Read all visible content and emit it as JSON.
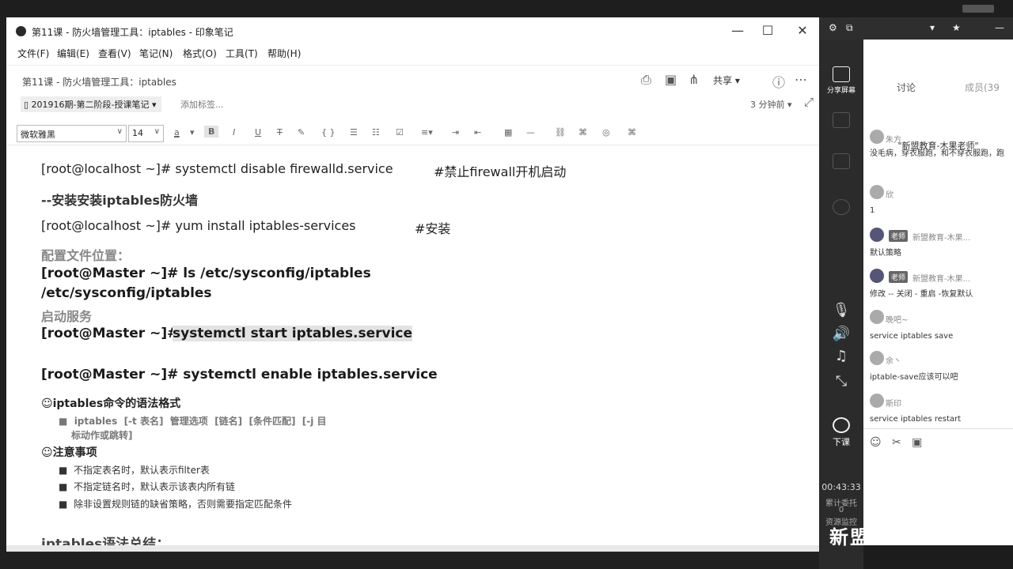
{
  "window": {
    "title": "第11课 - 防火墙管理工具：iptables - 印象笔记",
    "controls": {
      "minimize": "—",
      "maximize": "☐",
      "close": "✕"
    }
  },
  "menu": [
    "文件(F)",
    "编辑(E)",
    "查看(V)",
    "笔记(N)",
    "格式(O)",
    "工具(T)",
    "帮助(H)"
  ],
  "note": {
    "breadcrumb": "第11课 - 防火墙管理工具：iptables",
    "share_label": "共享",
    "notebook": "201916期-第二阶段-授课笔记",
    "add_tag": "添加标签...",
    "updated": "3 分钟前"
  },
  "format": {
    "font": "微软雅黑",
    "size": "14"
  },
  "content": {
    "l1_cmd": "[root@localhost ~]# systemctl disable firewalld.service",
    "l1_comment": "#禁止firewall开机启动",
    "l2": "--安装安装iptables防火墙",
    "l3_cmd": "[root@localhost ~]# yum install iptables-services",
    "l3_comment": "#安装",
    "l4": "配置文件位置：",
    "l5": "[root@Master ~]# ls /etc/sysconfig/iptables",
    "l6": "/etc/sysconfig/iptables",
    "l7": "启动服务",
    "l8_prompt": "[root@Master ~]#",
    "l8_cmd": "systemctl start iptables.service",
    "l9": "[root@Master ~]# systemctl enable iptables.service",
    "l10": "☺iptables命令的语法格式",
    "l11a": "■  iptables  [-t 表名]  管理选项  [链名]  [条件匹配]  [-j 目",
    "l11b": "标动作或跳转]",
    "l12": "☺注意事项",
    "b1": "■  不指定表名时，默认表示filter表",
    "b2": "■  不指定链名时，默认表示该表内所有链",
    "b3": "■  除非设置规则链的缺省策略，否则需要指定匹配条件",
    "l13": "iptables语法总结："
  },
  "side": {
    "share_screen": "分享屏幕",
    "leave": "下课",
    "clock": "00:43:33",
    "stat1": "累计委托",
    "stat2": "0",
    "stat3": "资源监控",
    "logo": "新盟"
  },
  "chat": {
    "tab_discuss": "讨论",
    "tab_members": "成员(39",
    "banner": "\"新盟教育-木果老师\"",
    "m1_name": "朱方",
    "m1_text": "没毛病，穿衣服跑，和不穿衣服跑，跑",
    "m2_name": "欣",
    "m2_text": "1",
    "m3_badge": "老师",
    "m3_name": "新盟教育-木果...",
    "m3_text": "默认策略",
    "m4_badge": "老师",
    "m4_name": "新盟教育-木果...",
    "m4_text": "修改 -- 关闭 - 重启 -恢复默认",
    "m5_name": "晚吧~",
    "m5_text": "service iptables save",
    "m6_name": "余丶",
    "m6_text": "iptable-save应该可以吧",
    "m7_name": "斯印",
    "m7_text": "service iptables restart"
  }
}
